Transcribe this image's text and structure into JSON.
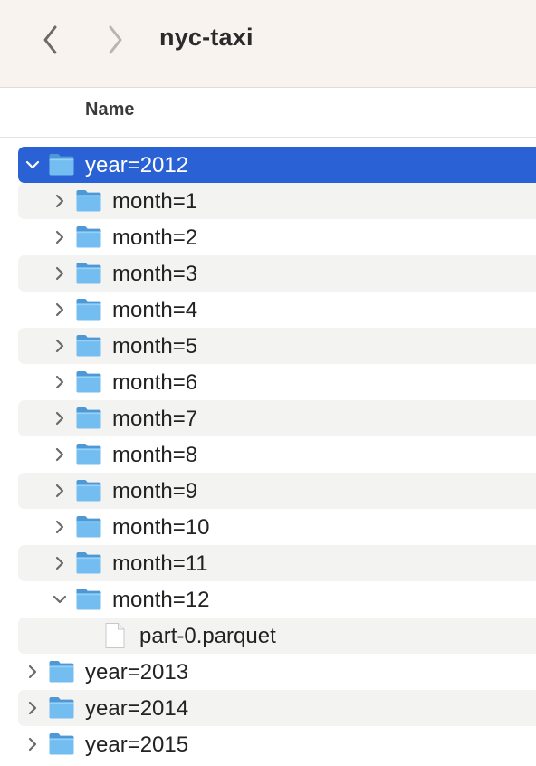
{
  "window": {
    "title": "nyc-taxi"
  },
  "toolbar": {
    "back_icon": "chevron-left-icon",
    "forward_icon": "chevron-right-icon"
  },
  "columns": {
    "name": "Name"
  },
  "colors": {
    "selection": "#2a62d6",
    "folder": "#6fb8ea",
    "toolbar_bg": "#f8f3ee"
  },
  "rows": [
    {
      "label": "year=2012",
      "kind": "folder",
      "expanded": true,
      "selected": true
    },
    {
      "label": "month=1",
      "kind": "folder",
      "expanded": false
    },
    {
      "label": "month=2",
      "kind": "folder",
      "expanded": false
    },
    {
      "label": "month=3",
      "kind": "folder",
      "expanded": false
    },
    {
      "label": "month=4",
      "kind": "folder",
      "expanded": false
    },
    {
      "label": "month=5",
      "kind": "folder",
      "expanded": false
    },
    {
      "label": "month=6",
      "kind": "folder",
      "expanded": false
    },
    {
      "label": "month=7",
      "kind": "folder",
      "expanded": false
    },
    {
      "label": "month=8",
      "kind": "folder",
      "expanded": false
    },
    {
      "label": "month=9",
      "kind": "folder",
      "expanded": false
    },
    {
      "label": "month=10",
      "kind": "folder",
      "expanded": false
    },
    {
      "label": "month=11",
      "kind": "folder",
      "expanded": false
    },
    {
      "label": "month=12",
      "kind": "folder",
      "expanded": true
    },
    {
      "label": "part-0.parquet",
      "kind": "file"
    },
    {
      "label": "year=2013",
      "kind": "folder",
      "expanded": false
    },
    {
      "label": "year=2014",
      "kind": "folder",
      "expanded": false
    },
    {
      "label": "year=2015",
      "kind": "folder",
      "expanded": false
    }
  ]
}
